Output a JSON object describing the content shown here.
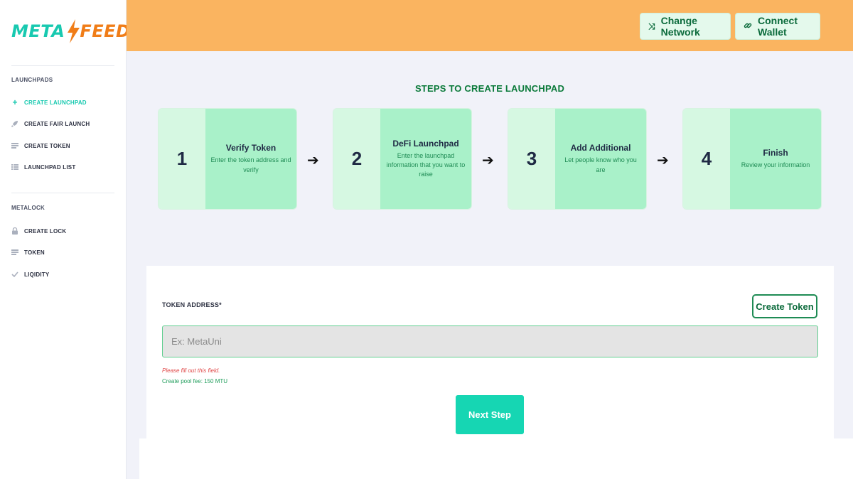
{
  "logo": {
    "part1": "META",
    "part2": "FEED"
  },
  "sidebar": {
    "sections": [
      {
        "title": "LAUNCHPADS",
        "items": [
          {
            "label": "CREATE LAUNCHPAD",
            "icon": "plus-icon",
            "active": true
          },
          {
            "label": "CREATE FAIR LAUNCH",
            "icon": "rocket-icon"
          },
          {
            "label": "CREATE TOKEN",
            "icon": "layers-icon"
          },
          {
            "label": "LAUNCHPAD LIST",
            "icon": "list-icon"
          }
        ]
      },
      {
        "title": "METALOCK",
        "items": [
          {
            "label": "CREATE LOCK",
            "icon": "lock-icon"
          },
          {
            "label": "TOKEN",
            "icon": "layers-icon"
          },
          {
            "label": "LIQIDITY",
            "icon": "check-icon"
          }
        ]
      }
    ]
  },
  "header": {
    "change_network": {
      "label": "Change Network",
      "icon": "shuffle-icon"
    },
    "connect_wallet": {
      "label": "Connect Wallet",
      "icon": "link-icon"
    }
  },
  "main": {
    "steps_title": "STEPS TO CREATE LAUNCHPAD",
    "steps": [
      {
        "num": "1",
        "title": "Verify Token",
        "desc": "Enter the token address and verify"
      },
      {
        "num": "2",
        "title": "DeFi Launchpad",
        "desc": "Enter the launchpad information that you want to raise"
      },
      {
        "num": "3",
        "title": "Add Additional",
        "desc": "Let people know who you are"
      },
      {
        "num": "4",
        "title": "Finish",
        "desc": "Review your information"
      }
    ],
    "arrow_glyph": "➔"
  },
  "form": {
    "token_address_label": "TOKEN ADDRESS*",
    "create_token_label": "Create Token",
    "input_placeholder": "Ex: MetaUni",
    "input_value": "",
    "error_text": "Please fill out this field.",
    "fee_text": "Create pool fee: 150 MTU",
    "next_label": "Next Step"
  },
  "colors": {
    "header_bg": "#fab460",
    "accent": "#16d6b3",
    "brand_green": "#0c6b3c",
    "logo_teal": "#18c9b0",
    "logo_orange": "#f07d18"
  }
}
